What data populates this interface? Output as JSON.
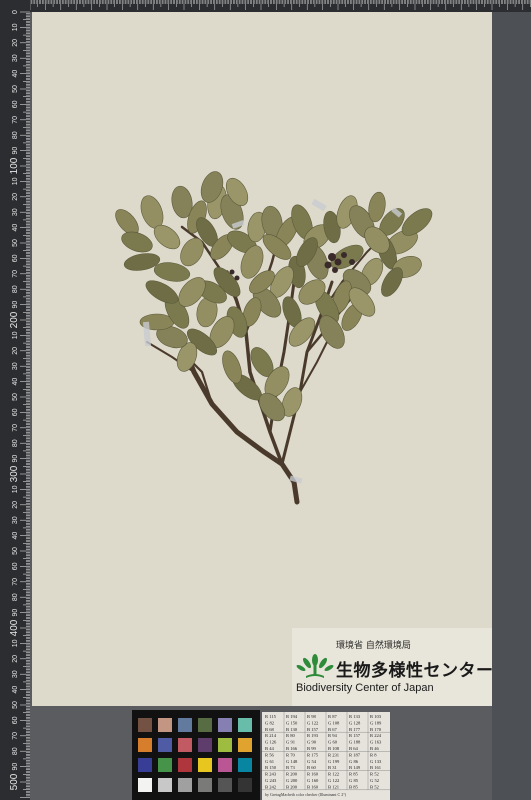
{
  "ruler": {
    "left_labels": [
      "0",
      "10",
      "20",
      "30",
      "40",
      "50",
      "60",
      "70",
      "80",
      "90",
      "100",
      "10",
      "20",
      "30",
      "40",
      "50",
      "60",
      "70",
      "80",
      "90",
      "200",
      "10",
      "20",
      "30",
      "40",
      "50",
      "60",
      "70",
      "80",
      "90",
      "300",
      "10",
      "20",
      "30",
      "40",
      "50",
      "60",
      "70",
      "80",
      "90",
      "400",
      "10",
      "20",
      "30",
      "40",
      "50",
      "60",
      "70",
      "80",
      "90",
      "500"
    ]
  },
  "logo": {
    "ministry": "環境省 自然環境局",
    "name_jp": "生物多様性センター",
    "name_en": "Biodiversity Center of Japan",
    "icon": "plant-sprout-logo-icon",
    "accent": "#2e8b3a"
  },
  "color_checker": {
    "patches": [
      "#735244",
      "#c29682",
      "#627a9d",
      "#576c43",
      "#8580b1",
      "#67bdaa",
      "#d67e2c",
      "#505ba6",
      "#c15a63",
      "#5e3c6c",
      "#9dbc40",
      "#e0a32e",
      "#383d96",
      "#469449",
      "#af363c",
      "#e7c71f",
      "#bb5695",
      "#0885a1",
      "#f3f3f2",
      "#c8c8c8",
      "#a0a0a0",
      "#7a7a79",
      "#555555",
      "#343434"
    ]
  },
  "color_table": {
    "rows": [
      [
        "R 115",
        "R 194",
        "R 98",
        "R 87",
        "R 133",
        "R 103"
      ],
      [
        "G 82",
        "G 150",
        "G 122",
        "G 108",
        "G 128",
        "G 189"
      ],
      [
        "B 68",
        "B 130",
        "B 157",
        "B 67",
        "B 177",
        "B 170"
      ],
      [
        "R 214",
        "R 80",
        "R 193",
        "R 94",
        "R 157",
        "R 224"
      ],
      [
        "G 126",
        "G 91",
        "G 90",
        "G 60",
        "G 188",
        "G 163"
      ],
      [
        "B 44",
        "B 166",
        "B 99",
        "B 108",
        "B 64",
        "B 46"
      ],
      [
        "R 56",
        "R 70",
        "R 175",
        "R 231",
        "R 187",
        "R 8"
      ],
      [
        "G 61",
        "G 148",
        "G 54",
        "G 199",
        "G 86",
        "G 133"
      ],
      [
        "B 150",
        "B 73",
        "B 60",
        "B 31",
        "B 149",
        "B 161"
      ],
      [
        "R 243",
        "R 200",
        "R 160",
        "R 122",
        "R 85",
        "R 52"
      ],
      [
        "G 243",
        "G 200",
        "G 160",
        "G 122",
        "G 85",
        "G 52"
      ],
      [
        "B 242",
        "B 200",
        "B 160",
        "B 121",
        "B 85",
        "B 52"
      ]
    ],
    "caption": "by GretagMacbeth color checker (Illuminant C 2°)"
  }
}
